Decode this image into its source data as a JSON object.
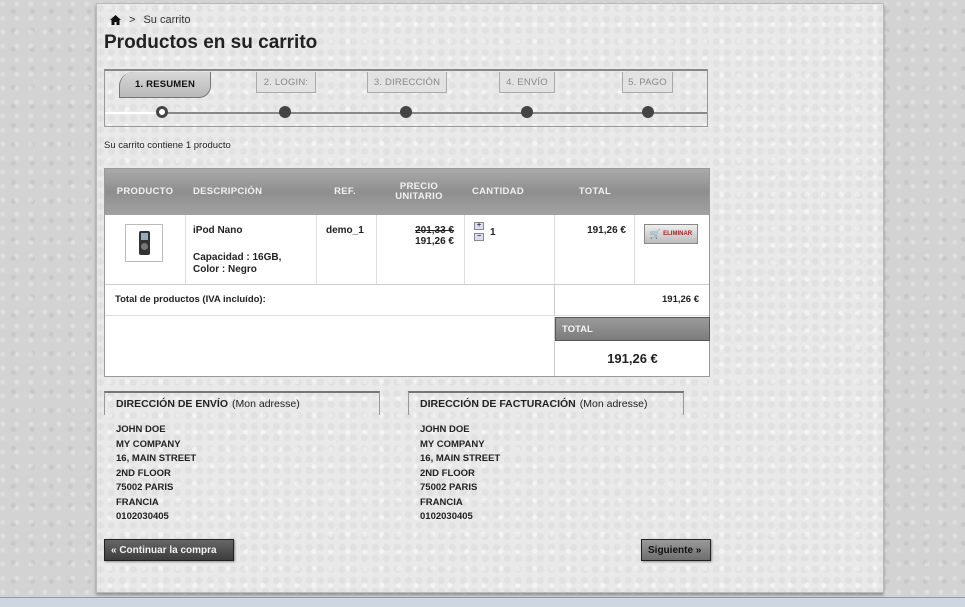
{
  "breadcrumb": {
    "current": "Su carrito"
  },
  "page_title": "Productos en su carrito",
  "steps": [
    {
      "label": "1. RESUMEN"
    },
    {
      "label": "2. LOGIN:"
    },
    {
      "label": "3. DIRECCIÓN"
    },
    {
      "label": "4. ENVÍO"
    },
    {
      "label": "5. PAGO"
    }
  ],
  "cart_count_text": "Su carrito contiene 1 producto",
  "table": {
    "headers": {
      "product": "PRODUCTO",
      "description": "DESCRIPCIÓN",
      "ref": "REF.",
      "unit_price_1": "PRECIO",
      "unit_price_2": "UNITARIO",
      "quantity": "CANTIDAD",
      "total": "TOTAL"
    },
    "row": {
      "name": "iPod Nano",
      "attributes": "Capacidad : 16GB, Color : Negro",
      "ref": "demo_1",
      "old_price": "201,33 €",
      "price": "191,26 €",
      "quantity": "1",
      "total": "191,26 €",
      "delete_label": "ELIMINAR",
      "qty_up": "+",
      "qty_down": "−"
    },
    "subtotal_label": "Total de productos (IVA incluído):",
    "subtotal_value": "191,26 €",
    "total_label": "TOTAL",
    "total_value": "191,26 €"
  },
  "shipping_address": {
    "title": "DIRECCIÓN DE ENVÍO",
    "alias": "(Mon adresse)",
    "lines": [
      "JOHN DOE",
      "MY COMPANY",
      "16, MAIN STREET",
      "2ND FLOOR",
      "75002 PARIS",
      "FRANCIA",
      "0102030405"
    ]
  },
  "billing_address": {
    "title": "DIRECCIÓN DE FACTURACIÓN",
    "alias": "(Mon adresse)",
    "lines": [
      "JOHN DOE",
      "MY COMPANY",
      "16, MAIN STREET",
      "2ND FLOOR",
      "75002 PARIS",
      "FRANCIA",
      "0102030405"
    ]
  },
  "buttons": {
    "continue": "« Continuar la compra",
    "next": "Siguiente »"
  },
  "icons": {
    "home": "home-icon",
    "cart": "cart-icon"
  }
}
